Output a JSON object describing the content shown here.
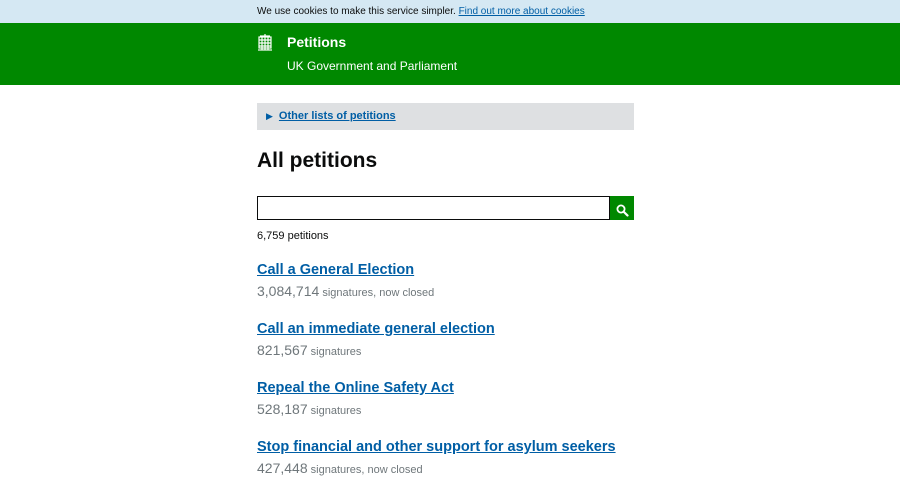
{
  "cookie_bar": {
    "text": "We use cookies to make this service simpler.",
    "link": "Find out more about cookies"
  },
  "header": {
    "title": "Petitions",
    "subtitle": "UK Government and Parliament",
    "icon": "portcullis-icon"
  },
  "nav": {
    "other_lists": "Other lists of petitions"
  },
  "page": {
    "title": "All petitions",
    "search_value": "",
    "count": "6,759 petitions"
  },
  "petitions": [
    {
      "title": "Call a General Election",
      "signatures": "3,084,714",
      "status": "signatures, now closed"
    },
    {
      "title": "Call an immediate general election",
      "signatures": "821,567",
      "status": "signatures"
    },
    {
      "title": "Repeal the Online Safety Act",
      "signatures": "528,187",
      "status": "signatures"
    },
    {
      "title": "Stop financial and other support for asylum seekers",
      "signatures": "427,448",
      "status": "signatures, now closed"
    }
  ],
  "colors": {
    "header_green": "#008800",
    "cookie_bg": "#d5e8f3",
    "link_blue": "#005ea5",
    "panel_grey": "#dee0e2"
  }
}
